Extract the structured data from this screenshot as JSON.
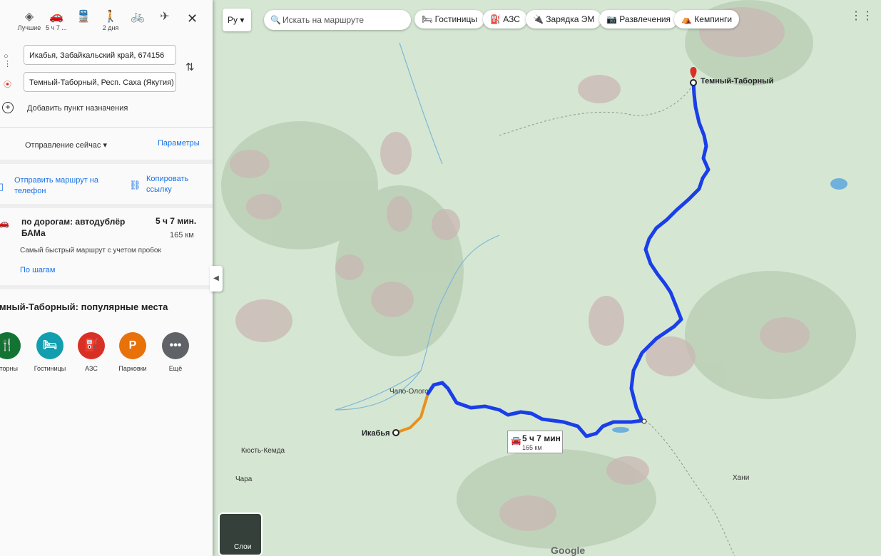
{
  "panel": {
    "modes": [
      {
        "icon": "diamond-icon",
        "label": "Лучшие",
        "selected": false
      },
      {
        "icon": "car-icon",
        "label": "5 ч 7 ...",
        "selected": true
      },
      {
        "icon": "train-icon",
        "label": "",
        "selected": false
      },
      {
        "icon": "walk-icon",
        "label": "2 дня",
        "selected": false
      },
      {
        "icon": "bicycle-icon",
        "label": "",
        "selected": false
      },
      {
        "icon": "plane-icon",
        "label": "",
        "selected": false
      }
    ],
    "origin": "Икабья, Забайкальский край, 674156",
    "destination": "Темный-Таборный, Респ. Саха (Якутия)",
    "add_stop": "Добавить пункт назначения",
    "depart": "Отправление сейчас",
    "params": "Параметры",
    "send_phone": "Отправить маршрут на телефон",
    "copy_link": "Копировать ссылку",
    "route": {
      "title": "по дорогам: автодублёр БАМа",
      "time": "5 ч 7 мин.",
      "distance": "165 км",
      "note": "Самый быстрый маршрут с учетом пробок",
      "steps": "По шагам"
    },
    "popular_title": "емный-Таборный: популярные места",
    "categories": [
      {
        "label": "сторны",
        "color": "#137333",
        "icon": "🍴"
      },
      {
        "label": "Гостиницы",
        "color": "#129eaf",
        "icon": "🛏"
      },
      {
        "label": "АЗС",
        "color": "#d93025",
        "icon": "⛽"
      },
      {
        "label": "Парковки",
        "color": "#e8710a",
        "icon": "P"
      },
      {
        "label": "Ещё",
        "color": "#5f6368",
        "icon": "•••"
      }
    ]
  },
  "topbar": {
    "lang": "Ру",
    "search_placeholder": "Искать на маршруте",
    "chips": [
      "Гостиницы",
      "АЗС",
      "Зарядка ЭМ",
      "Развлечения",
      "Кемпинги"
    ]
  },
  "map": {
    "labels": {
      "dest": "Темный-Таборный",
      "origin": "Икабья",
      "chapo": "Чапо-Олого",
      "kyust": "Кюсть-Кемда",
      "chara": "Чара",
      "khani": "Хани"
    },
    "route_box": {
      "time": "5 ч 7 мин",
      "distance": "165 км"
    },
    "layers": "Слои",
    "google": "Google"
  }
}
